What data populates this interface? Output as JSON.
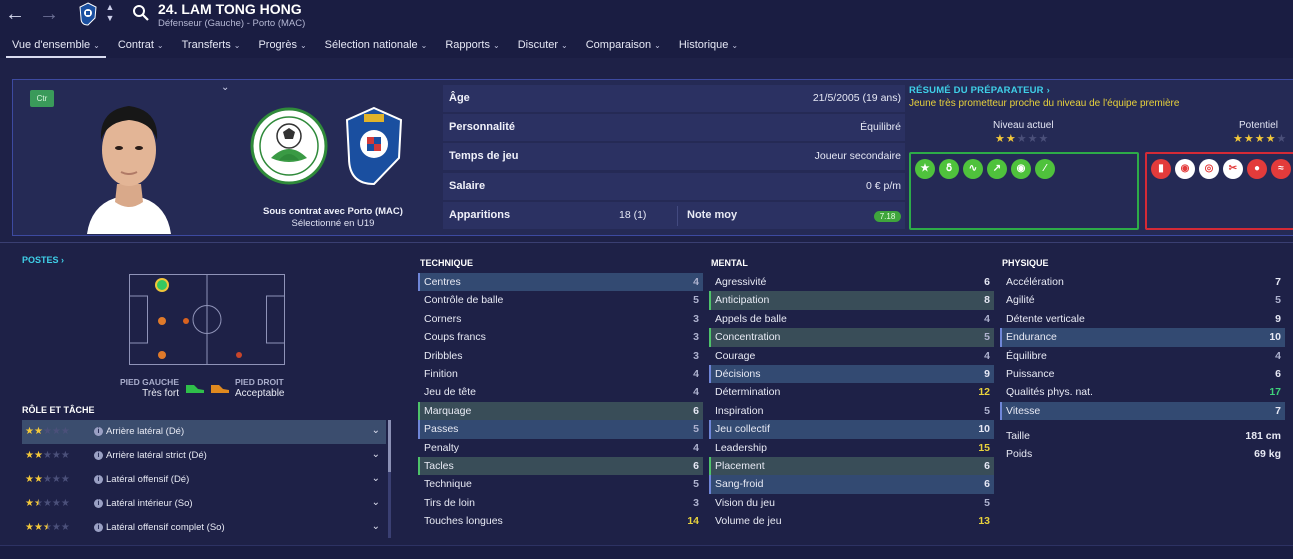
{
  "nav": {
    "back_icon": "arrow-left-icon",
    "forward_icon": "arrow-right-icon",
    "search_icon": "search-icon"
  },
  "player": {
    "title": "24. LAM TONG HONG",
    "subtitle": "Défenseur (Gauche) - Porto (MAC)",
    "role_badge": "Ctr",
    "contract": "Sous contrat avec Porto (MAC)",
    "selection": "Sélectionné en U19"
  },
  "tabs": [
    {
      "label": "Vue d'ensemble"
    },
    {
      "label": "Contrat"
    },
    {
      "label": "Transferts"
    },
    {
      "label": "Progrès"
    },
    {
      "label": "Sélection nationale"
    },
    {
      "label": "Rapports"
    },
    {
      "label": "Discuter"
    },
    {
      "label": "Comparaison"
    },
    {
      "label": "Historique"
    }
  ],
  "info": {
    "age_label": "Âge",
    "age_value": "21/5/2005 (19 ans)",
    "personality_label": "Personnalité",
    "personality_value": "Équilibré",
    "playtime_label": "Temps de jeu",
    "playtime_value": "Joueur secondaire",
    "salary_label": "Salaire",
    "salary_value": "0 € p/m",
    "apps_label": "Apparitions",
    "apps_value": "18 (1)",
    "avg_label": "Note moy",
    "avg_value": "7.18"
  },
  "scout": {
    "title": "RÉSUMÉ DU PRÉPARATEUR",
    "text": "Jeune très prometteur proche du niveau de l'équipe première",
    "current_label": "Niveau actuel",
    "current_stars": 2,
    "potential_label": "Potentiel",
    "potential_stars": 4,
    "strength_icons": [
      "star-icon",
      "runner-icon",
      "tackle-icon",
      "trend-up-icon",
      "head-icon",
      "boot-icon"
    ],
    "weakness_icons": [
      "card-icon",
      "head-fall-icon",
      "target-icon",
      "scissors-icon",
      "ball-icon",
      "cross-icon",
      "warning-icon"
    ]
  },
  "positions": {
    "title": "POSTES",
    "foot_left_label": "PIED GAUCHE",
    "foot_left_value": "Très fort",
    "foot_right_label": "PIED DROIT",
    "foot_right_value": "Acceptable"
  },
  "roles": {
    "title": "RÔLE ET TÂCHE",
    "items": [
      {
        "name": "Arrière latéral (Dé)",
        "stars": 2
      },
      {
        "name": "Arrière latéral strict (Dé)",
        "stars": 2
      },
      {
        "name": "Latéral offensif (Dé)",
        "stars": 2
      },
      {
        "name": "Latéral intérieur (So)",
        "stars": 1.5
      },
      {
        "name": "Latéral offensif complet (So)",
        "stars": 2.5
      }
    ]
  },
  "technique": {
    "title": "TECHNIQUE",
    "attrs": [
      {
        "name": "Centres",
        "value": "4"
      },
      {
        "name": "Contrôle de balle",
        "value": "5"
      },
      {
        "name": "Corners",
        "value": "3"
      },
      {
        "name": "Coups francs",
        "value": "3"
      },
      {
        "name": "Dribbles",
        "value": "3"
      },
      {
        "name": "Finition",
        "value": "4"
      },
      {
        "name": "Jeu de tête",
        "value": "4"
      },
      {
        "name": "Marquage",
        "value": "6"
      },
      {
        "name": "Passes",
        "value": "5"
      },
      {
        "name": "Penalty",
        "value": "4"
      },
      {
        "name": "Tacles",
        "value": "6"
      },
      {
        "name": "Technique",
        "value": "5"
      },
      {
        "name": "Tirs de loin",
        "value": "3"
      },
      {
        "name": "Touches longues",
        "value": "14"
      }
    ]
  },
  "mental": {
    "title": "MENTAL",
    "attrs": [
      {
        "name": "Agressivité",
        "value": "6"
      },
      {
        "name": "Anticipation",
        "value": "8"
      },
      {
        "name": "Appels de balle",
        "value": "4"
      },
      {
        "name": "Concentration",
        "value": "5"
      },
      {
        "name": "Courage",
        "value": "4"
      },
      {
        "name": "Décisions",
        "value": "9"
      },
      {
        "name": "Détermination",
        "value": "12"
      },
      {
        "name": "Inspiration",
        "value": "5"
      },
      {
        "name": "Jeu collectif",
        "value": "10"
      },
      {
        "name": "Leadership",
        "value": "15"
      },
      {
        "name": "Placement",
        "value": "6"
      },
      {
        "name": "Sang-froid",
        "value": "6"
      },
      {
        "name": "Vision du jeu",
        "value": "5"
      },
      {
        "name": "Volume de jeu",
        "value": "13"
      }
    ]
  },
  "physique": {
    "title": "PHYSIQUE",
    "attrs": [
      {
        "name": "Accélération",
        "value": "7"
      },
      {
        "name": "Agilité",
        "value": "5"
      },
      {
        "name": "Détente verticale",
        "value": "9"
      },
      {
        "name": "Endurance",
        "value": "10"
      },
      {
        "name": "Équilibre",
        "value": "4"
      },
      {
        "name": "Puissance",
        "value": "6"
      },
      {
        "name": "Qualités phys. nat.",
        "value": "17"
      },
      {
        "name": "Vitesse",
        "value": "7"
      }
    ],
    "height_label": "Taille",
    "height_value": "181 cm",
    "weight_label": "Poids",
    "weight_value": "69 kg"
  },
  "colors": {
    "background": "#1e2147",
    "accent_cyan": "#3fd0e8",
    "star": "#f3c83a",
    "strength": "#2dab48",
    "weakness": "#d42a36"
  }
}
